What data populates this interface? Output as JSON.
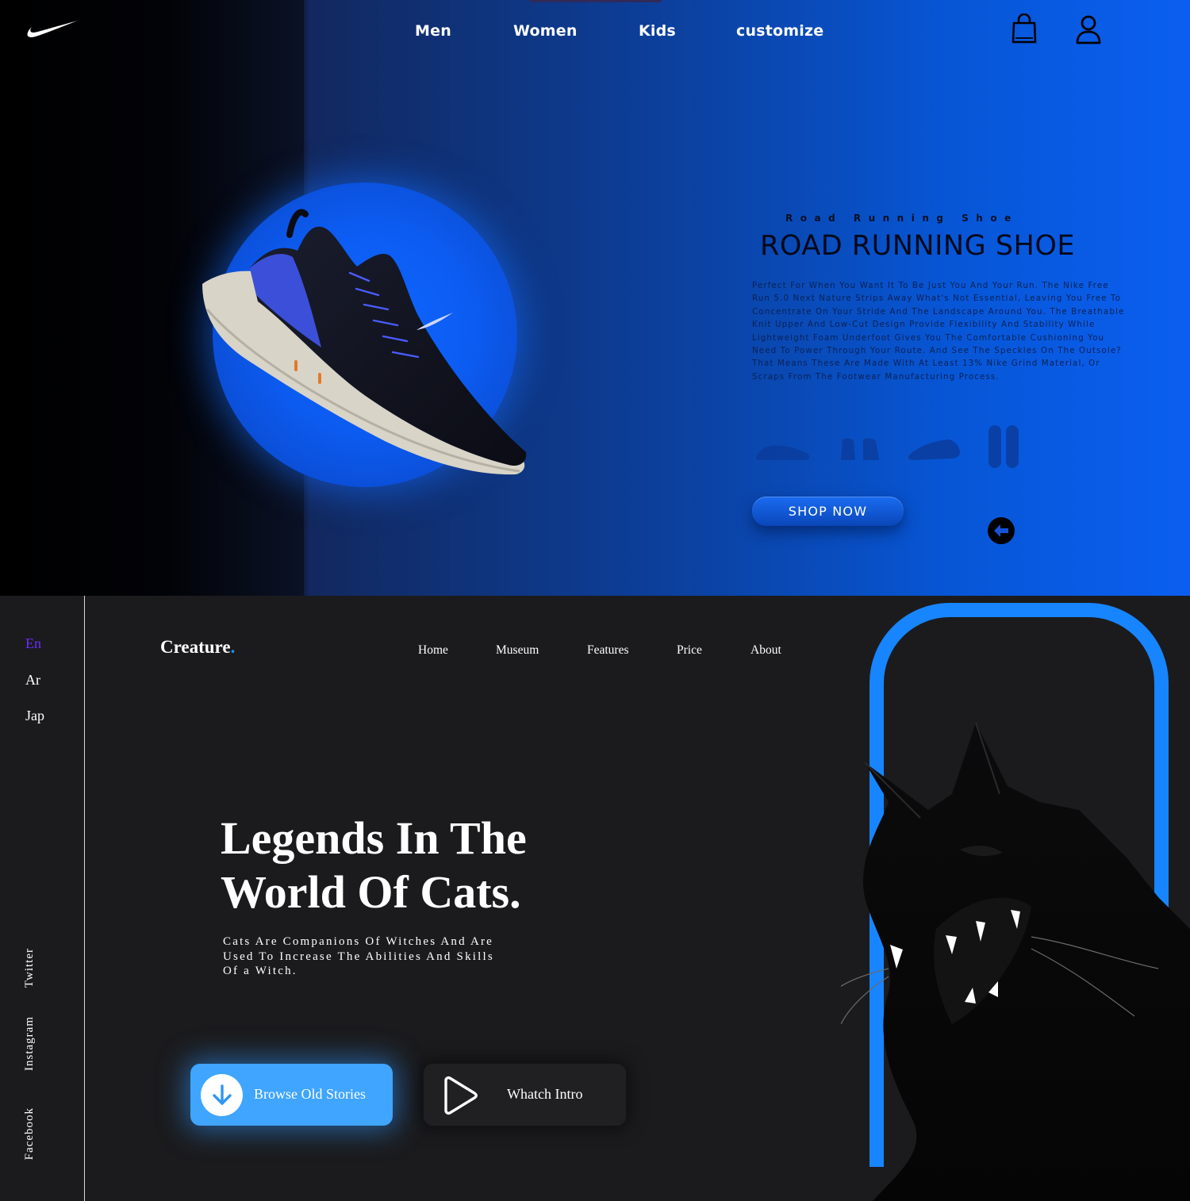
{
  "nike": {
    "logo": "nike-swoosh",
    "nav": [
      "Men",
      "Women",
      "Kids",
      "customize"
    ],
    "kicker": "Road Running Shoe",
    "title": "ROAD RUNNING SHOE",
    "description": "Perfect For When You Want It To Be Just You And Your Run. The Nike Free Run 5.0 Next Nature Strips Away What's Not Essential, Leaving You Free To Concentrate On Your Stride And The Landscape Around You. The Breathable Knit Upper And Low-Cut Design Provide Flexibility And Stability While Lightweight Foam Underfoot Gives You The Comfortable Cushioning You Need To Power Through Your Route. And See The Speckles On The Outsole? That Means These Are Made With At Least 13% Nike Grind Material, Or Scraps From The Footwear Manufacturing Process.",
    "shop_label": "SHOP NOW",
    "icons": [
      "shopping-bag-icon",
      "user-icon",
      "arrow-left-icon"
    ],
    "colors": {
      "accent": "#0b5ff0",
      "orb": "#0f66ff"
    }
  },
  "creature": {
    "languages": [
      "En",
      "Ar",
      "Jap"
    ],
    "active_language": "En",
    "social": [
      "Twitter",
      "Instagram",
      "Facebook"
    ],
    "brand": "Creature",
    "brand_dot": ".",
    "nav": [
      "Home",
      "Museum",
      "Features",
      "Price",
      "About"
    ],
    "headline_line1": "Legends In The",
    "headline_line2": "World Of Cats.",
    "subtitle_line1": "Cats Are Companions Of Witches And Are",
    "subtitle_line2": "Used To Increase The Abilities And Skills",
    "subtitle_line3": "Of a Witch.",
    "browse_label": "Browse Old Stories",
    "intro_label": "Whatch Intro",
    "icons": [
      "arrow-down-icon",
      "play-icon"
    ],
    "colors": {
      "accent": "#1e90ff",
      "button": "#3fa5ff",
      "active_language": "#6a2cff"
    }
  }
}
